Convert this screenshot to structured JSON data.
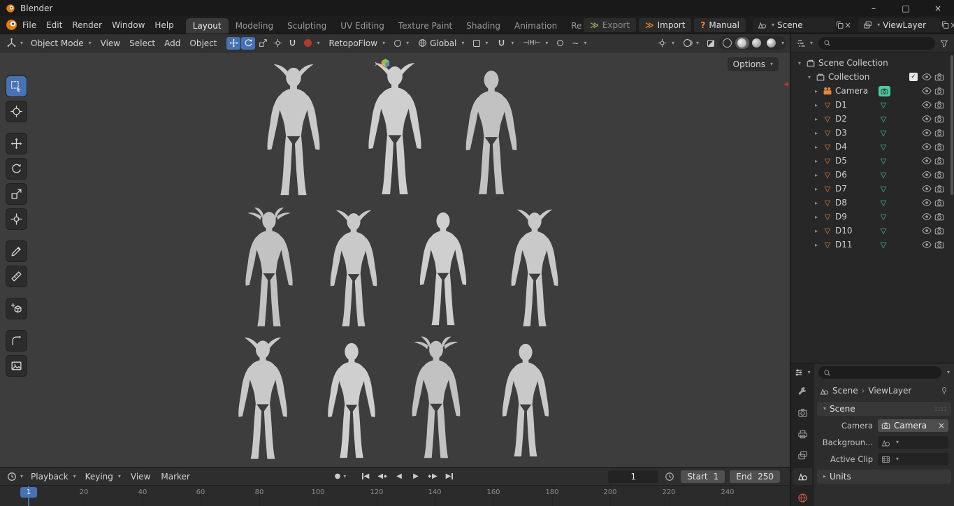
{
  "titlebar": {
    "title": "Blender",
    "minimize": "–",
    "maximize": "□",
    "close": "×"
  },
  "menubar": {
    "items": [
      "File",
      "Edit",
      "Render",
      "Window",
      "Help"
    ]
  },
  "workspaces": {
    "tabs": [
      "Layout",
      "Modeling",
      "Sculpting",
      "UV Editing",
      "Texture Paint",
      "Shading",
      "Animation",
      "Re"
    ]
  },
  "topbar": {
    "export": "Export",
    "import": "Import",
    "manual": "Manual",
    "scene": "Scene",
    "viewlayer": "ViewLayer"
  },
  "viewport": {
    "header": {
      "mode": "Object Mode",
      "menus": [
        "View",
        "Select",
        "Add",
        "Object"
      ],
      "retopoflow": "RetopoFlow",
      "orientation": "Global"
    },
    "options": "Options"
  },
  "outliner": {
    "root": "Scene Collection",
    "collection": "Collection",
    "objects": [
      {
        "name": "Camera",
        "type": "camera"
      },
      {
        "name": "D1",
        "type": "mesh"
      },
      {
        "name": "D2",
        "type": "mesh"
      },
      {
        "name": "D3",
        "type": "mesh"
      },
      {
        "name": "D4",
        "type": "mesh"
      },
      {
        "name": "D5",
        "type": "mesh"
      },
      {
        "name": "D6",
        "type": "mesh"
      },
      {
        "name": "D7",
        "type": "mesh"
      },
      {
        "name": "D8",
        "type": "mesh"
      },
      {
        "name": "D9",
        "type": "mesh"
      },
      {
        "name": "D10",
        "type": "mesh"
      },
      {
        "name": "D11",
        "type": "mesh"
      }
    ]
  },
  "properties": {
    "breadcrumb": {
      "scene": "Scene",
      "separator": "›",
      "viewlayer": "ViewLayer"
    },
    "sections": {
      "scene": "Scene",
      "units": "Units"
    },
    "fields": {
      "camera_label": "Camera",
      "camera_value": "Camera",
      "background_label": "Backgroun...",
      "active_clip_label": "Active Clip"
    }
  },
  "timeline": {
    "menus": [
      "Playback",
      "Keying",
      "View",
      "Marker"
    ],
    "current_frame": "1",
    "start_label": "Start",
    "start_value": "1",
    "end_label": "End",
    "end_value": "250",
    "playhead": "1",
    "ticks": [
      "20",
      "40",
      "60",
      "80",
      "100",
      "120",
      "140",
      "160",
      "180",
      "200",
      "220",
      "240"
    ]
  },
  "colors": {
    "accent_blue": "#4772b3",
    "object_orange": "#e8883a",
    "data_teal": "#43d0a0",
    "viewport_bg": "#3d3d3d"
  }
}
